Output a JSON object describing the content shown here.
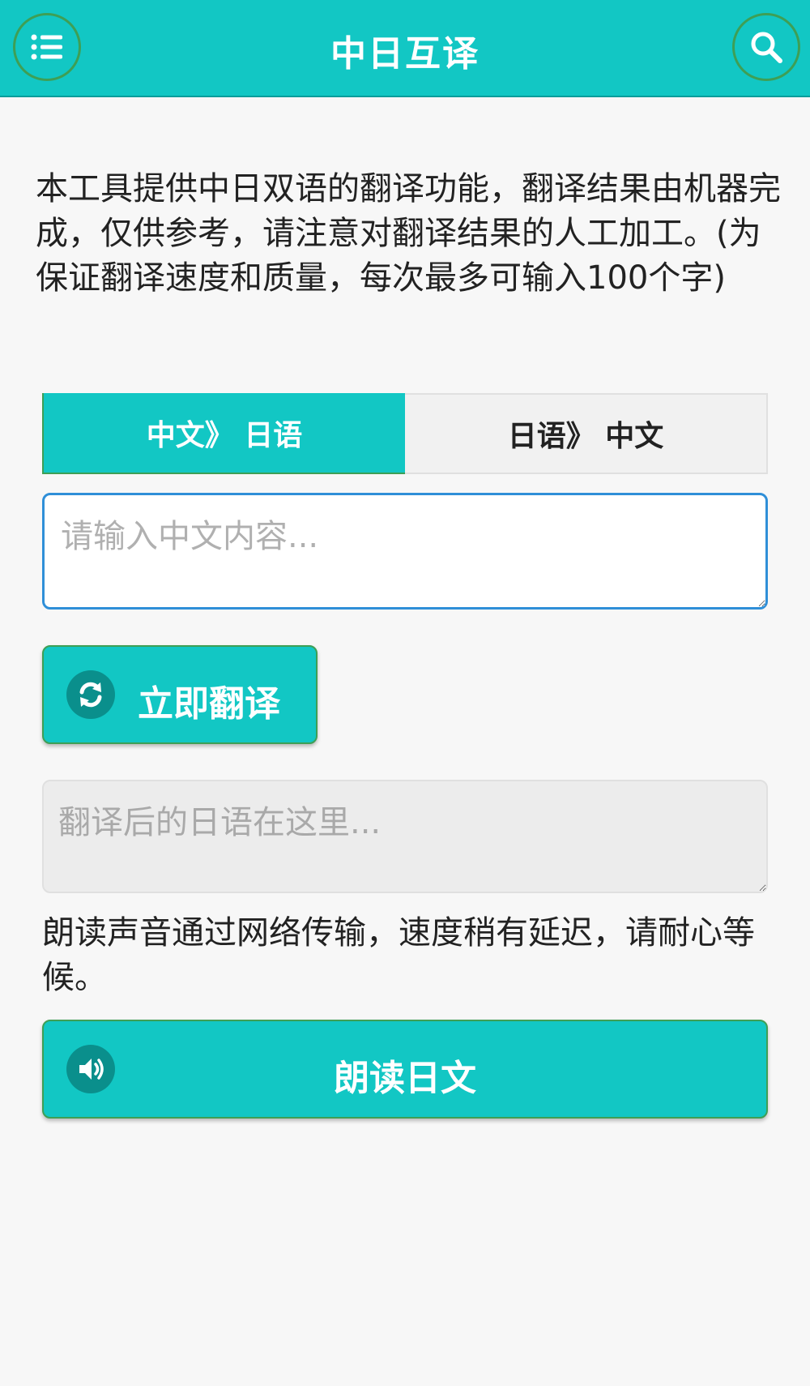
{
  "header": {
    "title": "中日互译",
    "menu_icon": "list-menu-icon",
    "search_icon": "search-icon"
  },
  "intro_text": "本工具提供中日双语的翻译功能，翻译结果由机器完成，仅供参考，请注意对翻译结果的人工加工。(为保证翻译速度和质量，每次最多可输入100个字)",
  "tabs": [
    {
      "label": "中文》 日语",
      "active": true
    },
    {
      "label": "日语》 中文",
      "active": false
    }
  ],
  "input": {
    "placeholder": "请输入中文内容...",
    "value": ""
  },
  "translate_button": {
    "label": "立即翻译",
    "icon": "refresh-icon"
  },
  "output": {
    "placeholder": "翻译后的日语在这里...",
    "value": ""
  },
  "notice_text": "朗读声音通过网络传输，速度稍有延迟，请耐心等候。",
  "read_button": {
    "label": "朗读日文",
    "icon": "speaker-icon"
  },
  "colors": {
    "accent": "#12c7c4",
    "accent_dark": "#0a8f8c",
    "border_green": "#3e9f55",
    "input_border": "#2f8fd8",
    "background": "#f7f7f7"
  }
}
